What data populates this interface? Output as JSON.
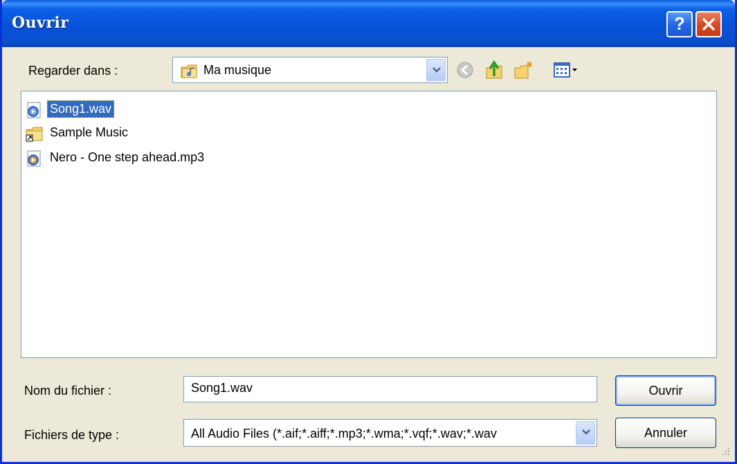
{
  "window": {
    "title": "Ouvrir",
    "help_label": "?"
  },
  "look_in": {
    "label": "Regarder dans :",
    "value": "Ma musique"
  },
  "files": [
    {
      "name": "Song1.wav",
      "icon": "audio-file-icon",
      "selected": true
    },
    {
      "name": "Sample Music",
      "icon": "folder-shortcut-icon",
      "selected": false
    },
    {
      "name": "Nero - One step ahead.mp3",
      "icon": "audio-file-icon",
      "selected": false
    }
  ],
  "filename": {
    "label": "Nom du fichier :",
    "value": "Song1.wav"
  },
  "filetype": {
    "label": "Fichiers de type :",
    "value": "All Audio Files (*.aif;*.aiff;*.mp3;*.wma;*.vqf;*.wav;*.wav"
  },
  "buttons": {
    "open": "Ouvrir",
    "cancel": "Annuler"
  },
  "colors": {
    "titlebar": "#0751d8",
    "selection": "#316ac5",
    "window_bg": "#ece9d8"
  }
}
